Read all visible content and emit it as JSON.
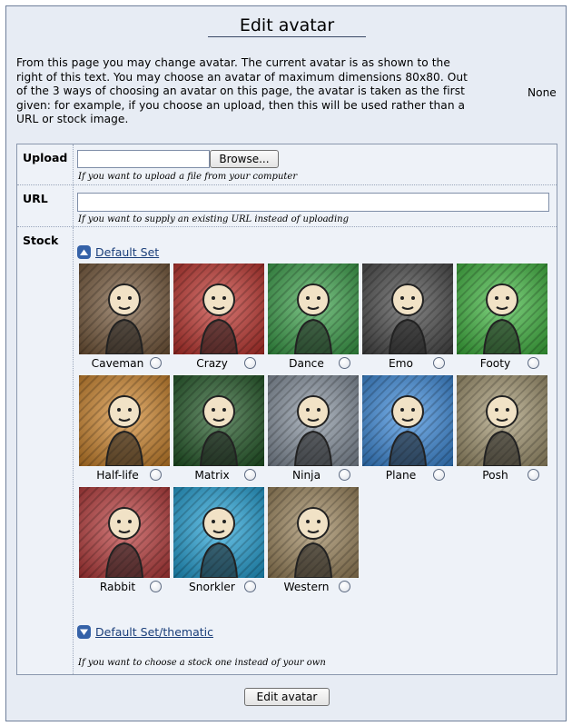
{
  "page": {
    "title": "Edit avatar",
    "intro": "From this page you may change avatar. The current avatar is as shown to the right of this text. You may choose an avatar of maximum dimensions 80x80. Out of the 3 ways of choosing an avatar on this page, the avatar is taken as the first given: for example, if you choose an upload, then this will be used rather than a URL or stock image.",
    "current_avatar": "None"
  },
  "upload": {
    "label": "Upload",
    "file_value": "",
    "browse_label": "Browse...",
    "hint": "If you want to upload a file from your computer"
  },
  "url": {
    "label": "URL",
    "value": "",
    "hint": "If you want to supply an existing URL instead of uploading"
  },
  "stock": {
    "label": "Stock",
    "set_expanded": "Default Set",
    "set_collapsed": "Default Set/thematic",
    "hint": "If you want to choose a stock one instead of your own",
    "avatars": [
      {
        "label": "Caveman",
        "color": "#7a5a3a"
      },
      {
        "label": "Crazy",
        "color": "#c8322b"
      },
      {
        "label": "Dance",
        "color": "#3aa84a"
      },
      {
        "label": "Emo",
        "color": "#4a4a4a"
      },
      {
        "label": "Footy",
        "color": "#3fbf3f"
      },
      {
        "label": "Half-life",
        "color": "#d98a2a"
      },
      {
        "label": "Matrix",
        "color": "#1f5a24"
      },
      {
        "label": "Ninja",
        "color": "#8a96a4"
      },
      {
        "label": "Plane",
        "color": "#3a8fe6"
      },
      {
        "label": "Posh",
        "color": "#a89a72"
      },
      {
        "label": "Rabbit",
        "color": "#c23a3a"
      },
      {
        "label": "Snorkler",
        "color": "#1fa8e0"
      },
      {
        "label": "Western",
        "color": "#a38a5e"
      }
    ]
  },
  "submit": {
    "label": "Edit avatar"
  }
}
